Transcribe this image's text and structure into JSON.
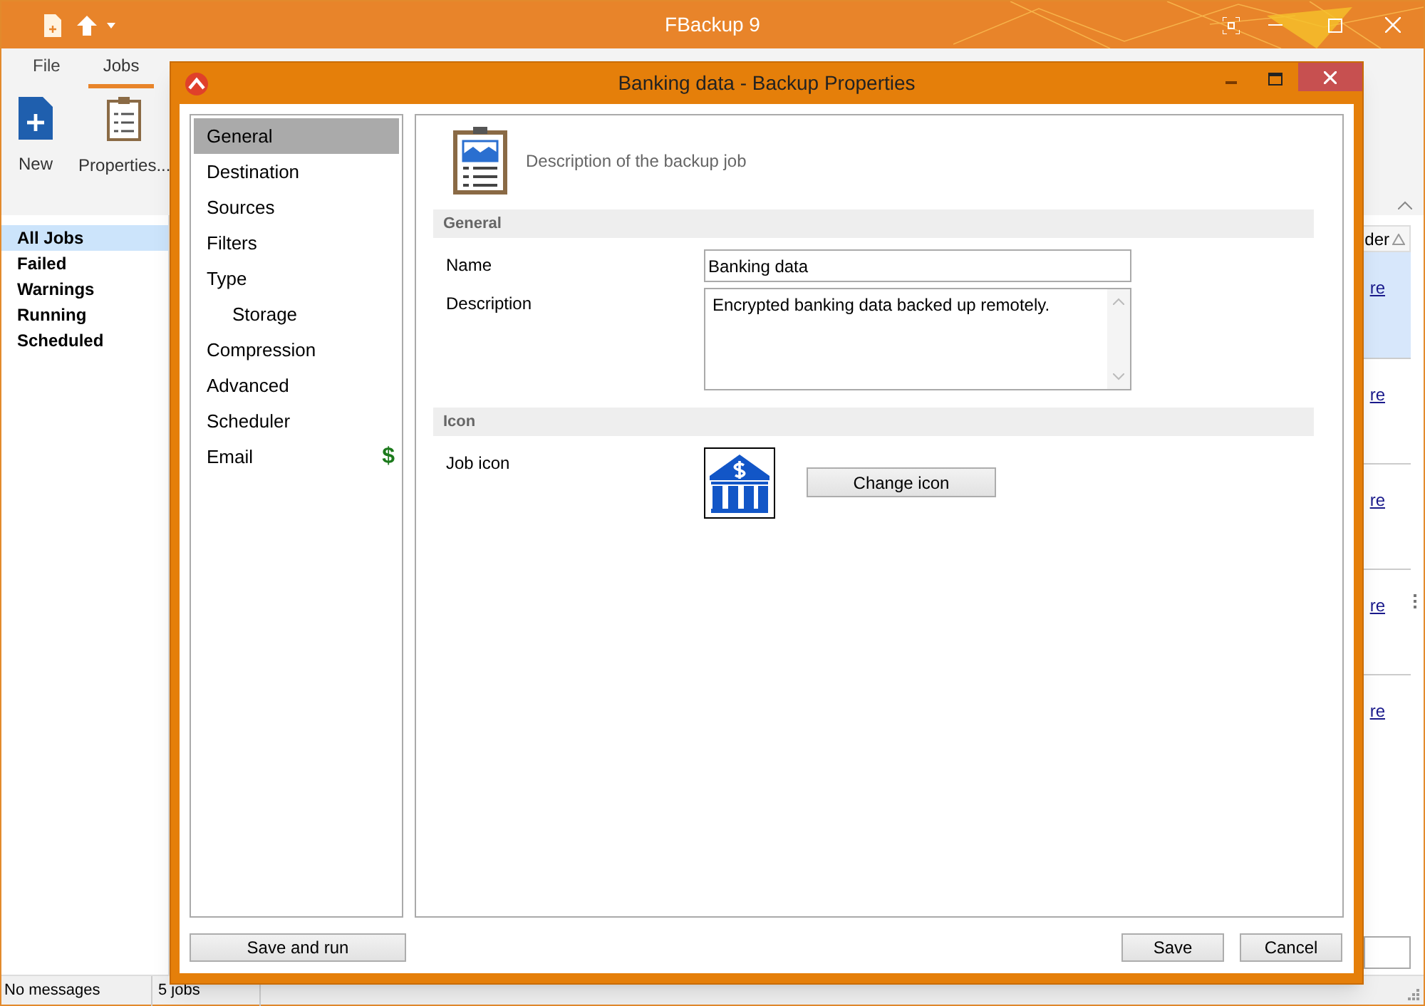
{
  "app": {
    "title": "FBackup 9"
  },
  "ribbon": {
    "tabs": [
      {
        "label": "File",
        "selected": false
      },
      {
        "label": "Jobs",
        "selected": true
      }
    ],
    "buttons": [
      {
        "label": "New",
        "kind": "new"
      },
      {
        "label": "Properties...",
        "kind": "properties"
      }
    ]
  },
  "job_filters": [
    {
      "label": "All Jobs",
      "selected": true
    },
    {
      "label": "Failed",
      "selected": false
    },
    {
      "label": "Warnings",
      "selected": false
    },
    {
      "label": "Running",
      "selected": false
    },
    {
      "label": "Scheduled",
      "selected": false
    }
  ],
  "jobs_table": {
    "column_header": "der",
    "rows": [
      {
        "link": "re",
        "selected": true
      },
      {
        "link": "re",
        "selected": false
      },
      {
        "link": "re",
        "selected": false
      },
      {
        "link": "re",
        "selected": false
      },
      {
        "link": "re",
        "selected": false
      }
    ]
  },
  "status_bar": [
    "No messages",
    "5 jobs"
  ],
  "dialog": {
    "title": "Banking data - Backup Properties",
    "nav": [
      {
        "label": "General",
        "selected": true
      },
      {
        "label": "Destination",
        "selected": false
      },
      {
        "label": "Sources",
        "selected": false
      },
      {
        "label": "Filters",
        "selected": false
      },
      {
        "label": "Type",
        "selected": false,
        "children": [
          {
            "label": "Storage",
            "selected": false
          }
        ]
      },
      {
        "label": "Compression",
        "selected": false
      },
      {
        "label": "Advanced",
        "selected": false
      },
      {
        "label": "Scheduler",
        "selected": false
      },
      {
        "label": "Email",
        "selected": false,
        "badge": "$"
      }
    ],
    "header": "Description of the backup job",
    "sections": [
      {
        "title": "General",
        "fields": [
          {
            "kind": "text",
            "label": "Name",
            "value": "Banking data"
          },
          {
            "kind": "textarea",
            "label": "Description",
            "value": "Encrypted banking data backed up remotely."
          }
        ]
      },
      {
        "title": "Icon",
        "fields": [
          {
            "kind": "icon",
            "label": "Job icon",
            "button": "Change icon"
          }
        ]
      }
    ],
    "left_button": "Save and run",
    "buttons": [
      "Save",
      "Cancel"
    ]
  }
}
